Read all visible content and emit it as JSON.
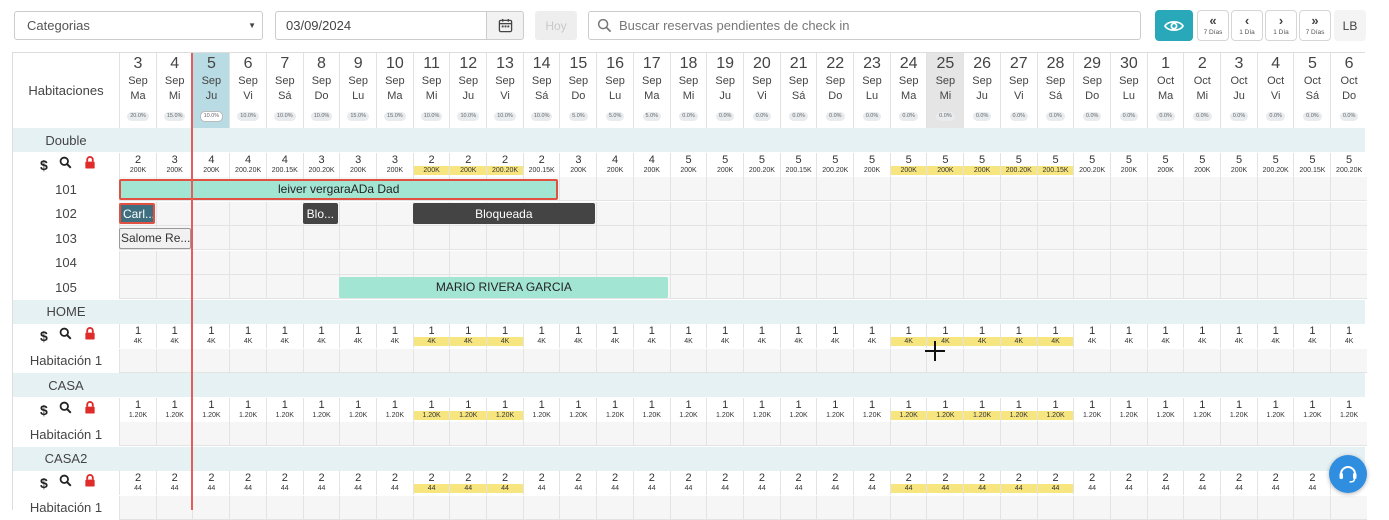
{
  "toolbar": {
    "category_value": "Categorias",
    "date_value": "03/09/2024",
    "today_label": "Hoy",
    "search_placeholder": "Buscar reservas pendientes de check in",
    "nav": [
      {
        "arrow": "«",
        "label": "7 Días"
      },
      {
        "arrow": "‹",
        "label": "1 Día"
      },
      {
        "arrow": "›",
        "label": "1 Día"
      },
      {
        "arrow": "»",
        "label": "7 Días"
      }
    ],
    "user_initials": "LB"
  },
  "rooms_header": "Habitaciones",
  "days": [
    {
      "num": "3",
      "mon": "Sep",
      "dow": "Ma",
      "pct": "20.0%"
    },
    {
      "num": "4",
      "mon": "Sep",
      "dow": "Mi",
      "pct": "15.0%"
    },
    {
      "num": "5",
      "mon": "Sep",
      "dow": "Ju",
      "pct": "10.0%"
    },
    {
      "num": "6",
      "mon": "Sep",
      "dow": "Vi",
      "pct": "10.0%"
    },
    {
      "num": "7",
      "mon": "Sep",
      "dow": "Sá",
      "pct": "10.0%"
    },
    {
      "num": "8",
      "mon": "Sep",
      "dow": "Do",
      "pct": "10.0%"
    },
    {
      "num": "9",
      "mon": "Sep",
      "dow": "Lu",
      "pct": "15.0%"
    },
    {
      "num": "10",
      "mon": "Sep",
      "dow": "Ma",
      "pct": "15.0%"
    },
    {
      "num": "11",
      "mon": "Sep",
      "dow": "Mi",
      "pct": "10.0%"
    },
    {
      "num": "12",
      "mon": "Sep",
      "dow": "Ju",
      "pct": "10.0%"
    },
    {
      "num": "13",
      "mon": "Sep",
      "dow": "Vi",
      "pct": "10.0%"
    },
    {
      "num": "14",
      "mon": "Sep",
      "dow": "Sá",
      "pct": "10.0%"
    },
    {
      "num": "15",
      "mon": "Sep",
      "dow": "Do",
      "pct": "5.0%"
    },
    {
      "num": "16",
      "mon": "Sep",
      "dow": "Lu",
      "pct": "5.0%"
    },
    {
      "num": "17",
      "mon": "Sep",
      "dow": "Ma",
      "pct": "5.0%"
    },
    {
      "num": "18",
      "mon": "Sep",
      "dow": "Mi",
      "pct": "0.0%"
    },
    {
      "num": "19",
      "mon": "Sep",
      "dow": "Ju",
      "pct": "0.0%"
    },
    {
      "num": "20",
      "mon": "Sep",
      "dow": "Vi",
      "pct": "0.0%"
    },
    {
      "num": "21",
      "mon": "Sep",
      "dow": "Sá",
      "pct": "0.0%"
    },
    {
      "num": "22",
      "mon": "Sep",
      "dow": "Do",
      "pct": "0.0%"
    },
    {
      "num": "23",
      "mon": "Sep",
      "dow": "Lu",
      "pct": "0.0%"
    },
    {
      "num": "24",
      "mon": "Sep",
      "dow": "Ma",
      "pct": "0.0%"
    },
    {
      "num": "25",
      "mon": "Sep",
      "dow": "Mi",
      "pct": "0.0%"
    },
    {
      "num": "26",
      "mon": "Sep",
      "dow": "Ju",
      "pct": "0.0%"
    },
    {
      "num": "27",
      "mon": "Sep",
      "dow": "Vi",
      "pct": "0.0%"
    },
    {
      "num": "28",
      "mon": "Sep",
      "dow": "Sá",
      "pct": "0.0%"
    },
    {
      "num": "29",
      "mon": "Sep",
      "dow": "Do",
      "pct": "0.0%"
    },
    {
      "num": "30",
      "mon": "Sep",
      "dow": "Lu",
      "pct": "0.0%"
    },
    {
      "num": "1",
      "mon": "Oct",
      "dow": "Ma",
      "pct": "0.0%"
    },
    {
      "num": "2",
      "mon": "Oct",
      "dow": "Mi",
      "pct": "0.0%"
    },
    {
      "num": "3",
      "mon": "Oct",
      "dow": "Ju",
      "pct": "0.0%"
    },
    {
      "num": "4",
      "mon": "Oct",
      "dow": "Vi",
      "pct": "0.0%"
    },
    {
      "num": "5",
      "mon": "Oct",
      "dow": "Sá",
      "pct": "0.0%"
    },
    {
      "num": "6",
      "mon": "Oct",
      "dow": "Do",
      "pct": "0.0%"
    }
  ],
  "today_index": 2,
  "dimmed_index": 22,
  "categories": [
    {
      "name": "Double",
      "availability": [
        "2",
        "3",
        "4",
        "4",
        "4",
        "3",
        "3",
        "3",
        "2",
        "2",
        "2",
        "2",
        "3",
        "4",
        "4",
        "5",
        "5",
        "5",
        "5",
        "5",
        "5",
        "5",
        "5",
        "5",
        "5",
        "5",
        "5",
        "5",
        "5",
        "5",
        "5",
        "5",
        "5",
        "5"
      ],
      "prices": [
        "200K",
        "200K",
        "200K",
        "200.20K",
        "200.15K",
        "200.20K",
        "200K",
        "200K",
        "200K",
        "200K",
        "200.20K",
        "200.15K",
        "200K",
        "200K",
        "200K",
        "200K",
        "200K",
        "200.20K",
        "200.15K",
        "200.20K",
        "200K",
        "200K",
        "200K",
        "200K",
        "200.20K",
        "200.15K",
        "200.20K",
        "200K",
        "200K",
        "200K",
        "200K",
        "200.20K",
        "200.15K",
        "200.20K"
      ],
      "highlighted": [
        8,
        9,
        10,
        21,
        22,
        23,
        24,
        25
      ],
      "rooms": [
        {
          "name": "101",
          "bookings": [
            {
              "label": "leiver vergaraADa Dad",
              "start": 0,
              "end": 12,
              "style": "green outlined"
            }
          ]
        },
        {
          "name": "102",
          "bookings": [
            {
              "label": "Carl...",
              "start": 0,
              "end": 1,
              "style": "blue"
            },
            {
              "label": "Blo...",
              "start": 5,
              "end": 6,
              "style": "dark"
            },
            {
              "label": "Bloqueada",
              "start": 8,
              "end": 13,
              "style": "dark"
            }
          ]
        },
        {
          "name": "103",
          "bookings": [
            {
              "label": "Salome Re...",
              "start": 0,
              "end": 2,
              "style": "grey"
            }
          ]
        },
        {
          "name": "104",
          "bookings": []
        },
        {
          "name": "105",
          "bookings": [
            {
              "label": "MARIO RIVERA GARCIA",
              "start": 6,
              "end": 15,
              "style": "green"
            }
          ]
        }
      ]
    },
    {
      "name": "HOME",
      "availability": [
        "1",
        "1",
        "1",
        "1",
        "1",
        "1",
        "1",
        "1",
        "1",
        "1",
        "1",
        "1",
        "1",
        "1",
        "1",
        "1",
        "1",
        "1",
        "1",
        "1",
        "1",
        "1",
        "1",
        "1",
        "1",
        "1",
        "1",
        "1",
        "1",
        "1",
        "1",
        "1",
        "1",
        "1"
      ],
      "prices": [
        "4K",
        "4K",
        "4K",
        "4K",
        "4K",
        "4K",
        "4K",
        "4K",
        "4K",
        "4K",
        "4K",
        "4K",
        "4K",
        "4K",
        "4K",
        "4K",
        "4K",
        "4K",
        "4K",
        "4K",
        "4K",
        "4K",
        "4K",
        "4K",
        "4K",
        "4K",
        "4K",
        "4K",
        "4K",
        "4K",
        "4K",
        "4K",
        "4K",
        "4K"
      ],
      "highlighted": [
        8,
        9,
        10,
        21,
        22,
        23,
        24,
        25
      ],
      "rooms": [
        {
          "name": "Habitación 1",
          "bookings": []
        }
      ]
    },
    {
      "name": "CASA",
      "availability": [
        "1",
        "1",
        "1",
        "1",
        "1",
        "1",
        "1",
        "1",
        "1",
        "1",
        "1",
        "1",
        "1",
        "1",
        "1",
        "1",
        "1",
        "1",
        "1",
        "1",
        "1",
        "1",
        "1",
        "1",
        "1",
        "1",
        "1",
        "1",
        "1",
        "1",
        "1",
        "1",
        "1",
        "1"
      ],
      "prices": [
        "1.20K",
        "1.20K",
        "1.20K",
        "1.20K",
        "1.20K",
        "1.20K",
        "1.20K",
        "1.20K",
        "1.20K",
        "1.20K",
        "1.20K",
        "1.20K",
        "1.20K",
        "1.20K",
        "1.20K",
        "1.20K",
        "1.20K",
        "1.20K",
        "1.20K",
        "1.20K",
        "1.20K",
        "1.20K",
        "1.20K",
        "1.20K",
        "1.20K",
        "1.20K",
        "1.20K",
        "1.20K",
        "1.20K",
        "1.20K",
        "1.20K",
        "1.20K",
        "1.20K",
        "1.20K"
      ],
      "highlighted": [
        8,
        9,
        10,
        21,
        22,
        23,
        24,
        25
      ],
      "rooms": [
        {
          "name": "Habitación 1",
          "bookings": []
        }
      ]
    },
    {
      "name": "CASA2",
      "availability": [
        "2",
        "2",
        "2",
        "2",
        "2",
        "2",
        "2",
        "2",
        "2",
        "2",
        "2",
        "2",
        "2",
        "2",
        "2",
        "2",
        "2",
        "2",
        "2",
        "2",
        "2",
        "2",
        "2",
        "2",
        "2",
        "2",
        "2",
        "2",
        "2",
        "2",
        "2",
        "2",
        "2",
        "2"
      ],
      "prices": [
        "44",
        "44",
        "44",
        "44",
        "44",
        "44",
        "44",
        "44",
        "44",
        "44",
        "44",
        "44",
        "44",
        "44",
        "44",
        "44",
        "44",
        "44",
        "44",
        "44",
        "44",
        "44",
        "44",
        "44",
        "44",
        "44",
        "44",
        "44",
        "44",
        "44",
        "44",
        "44",
        "44",
        "44"
      ],
      "highlighted": [
        8,
        9,
        10,
        21,
        22,
        23,
        24,
        25
      ],
      "rooms": [
        {
          "name": "Habitación 1",
          "bookings": []
        }
      ]
    }
  ],
  "colors": {
    "accent": "#28a8b8",
    "today_header": "#b8dbe4",
    "category_band": "#e6f1f4",
    "price_highlight": "#f7e680",
    "today_line": "#e35d5d",
    "booking_green": "#a3e5d3",
    "blocked": "#444444"
  },
  "icons": [
    "dollar-icon",
    "search-icon",
    "lock-icon",
    "calendar-icon",
    "eye-icon",
    "support-chat-icon"
  ]
}
